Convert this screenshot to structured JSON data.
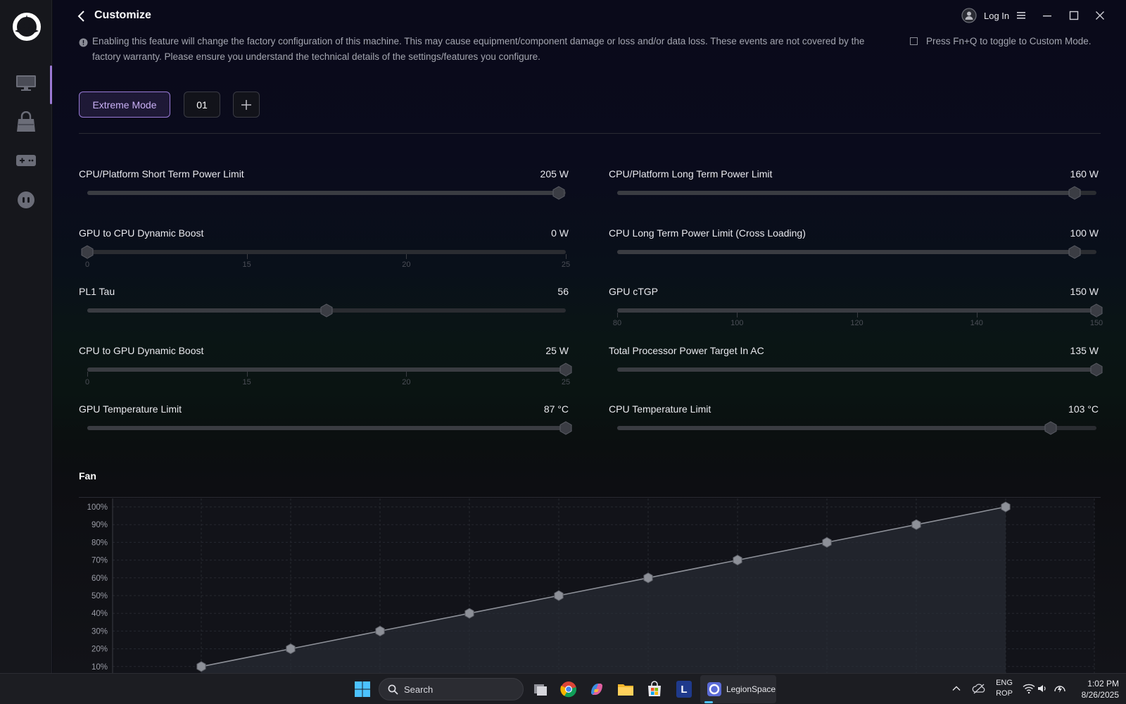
{
  "header": {
    "title": "Customize",
    "login_label": "Log In"
  },
  "notice": {
    "line1": "Enabling this feature will change the factory configuration of this machine. This may cause equipment/component damage or loss and/or data loss. These events are not covered by the",
    "line2": "factory warranty. Please ensure you understand the technical details of the settings/features you configure.",
    "toggle_hint": "Press Fn+Q to toggle to Custom Mode."
  },
  "modes": {
    "active": "Extreme Mode",
    "profile": "01"
  },
  "settings": [
    {
      "label": "CPU/Platform Short Term Power Limit",
      "value": "205 W",
      "level": 0.985,
      "ticks": []
    },
    {
      "label": "CPU/Platform Long Term Power Limit",
      "value": "160 W",
      "level": 0.955,
      "ticks": []
    },
    {
      "label": "GPU to CPU Dynamic Boost",
      "value": "0 W",
      "level": 0.0,
      "ticks": [
        "0",
        "15",
        "20",
        "25"
      ]
    },
    {
      "label": "CPU Long Term Power Limit (Cross Loading)",
      "value": "100 W",
      "level": 0.955,
      "ticks": []
    },
    {
      "label": "PL1 Tau",
      "value": "56",
      "level": 0.5,
      "ticks": []
    },
    {
      "label": "GPU cTGP",
      "value": "150 W",
      "level": 1.0,
      "ticks": [
        "80",
        "100",
        "120",
        "140",
        "150"
      ]
    },
    {
      "label": "CPU to GPU Dynamic Boost",
      "value": "25 W",
      "level": 1.0,
      "ticks": [
        "0",
        "15",
        "20",
        "25"
      ]
    },
    {
      "label": "Total Processor Power Target In AC",
      "value": "135 W",
      "level": 1.0,
      "ticks": []
    },
    {
      "label": "GPU Temperature Limit",
      "value": "87 °C",
      "level": 1.0,
      "ticks": []
    },
    {
      "label": "CPU Temperature Limit",
      "value": "103 °C",
      "level": 0.905,
      "ticks": []
    }
  ],
  "fan": {
    "title": "Fan"
  },
  "chart_data": {
    "type": "line",
    "title": "",
    "xlabel": "",
    "ylabel": "",
    "ylim": [
      0,
      100
    ],
    "y_tick_labels": [
      "100%",
      "90%",
      "80%",
      "70%",
      "60%",
      "50%",
      "40%",
      "30%",
      "20%",
      "10%"
    ],
    "x": [
      1,
      2,
      3,
      4,
      5,
      6,
      7,
      8,
      9,
      10
    ],
    "series": [
      {
        "values": [
          10,
          20,
          30,
          40,
          50,
          60,
          70,
          80,
          90,
          100
        ]
      }
    ],
    "grid": true,
    "colors": {
      "line": "#8d9098",
      "point": "#8d9098",
      "fill": "#2a2e38"
    }
  },
  "taskbar": {
    "search_label": "Search",
    "app_label": "LegionSpace",
    "lang_top": "ENG",
    "lang_bottom": "ROP",
    "time": "1:02 PM",
    "date": "8/26/2025"
  },
  "colors": {
    "accent": "#9c7ad6"
  }
}
